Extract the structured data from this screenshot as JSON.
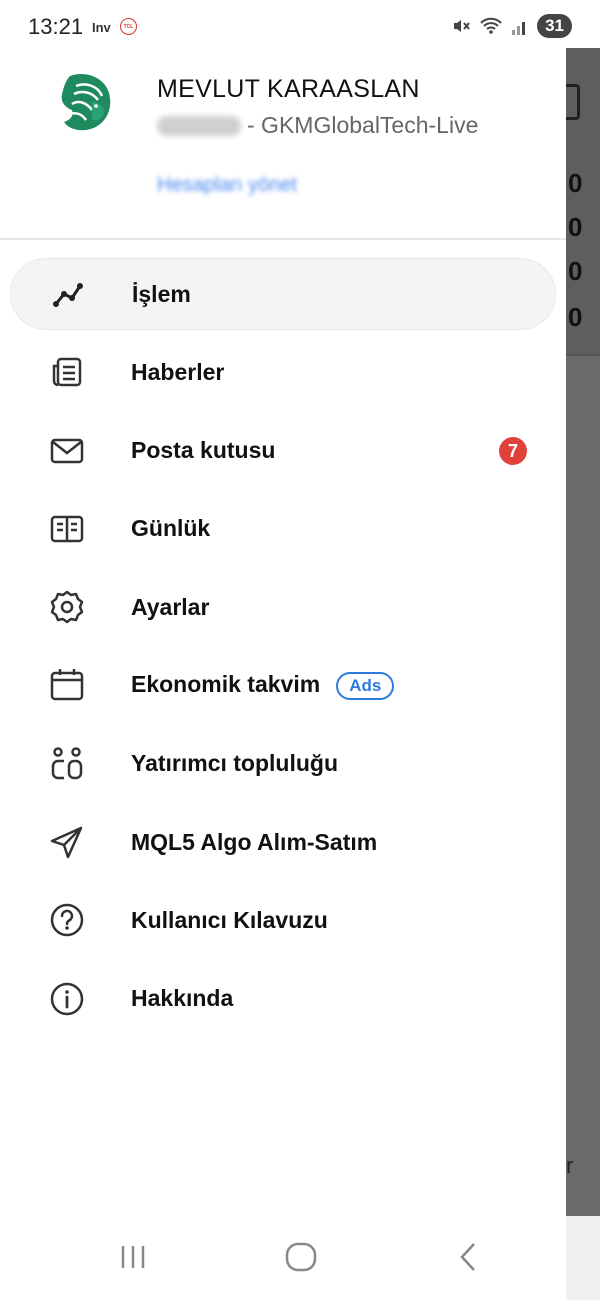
{
  "status_bar": {
    "time": "13:21",
    "app_tag": "Inv",
    "carrier_badge": "TCL",
    "battery": "31"
  },
  "drawer": {
    "user_name": "MEVLUT KARAASLAN",
    "account_server": "- GKMGlobalTech-Live",
    "manage_accounts": "Hesapları yönet",
    "menu": [
      {
        "label": "İşlem",
        "icon": "trade-chart-icon",
        "active": true
      },
      {
        "label": "Haberler",
        "icon": "news-icon"
      },
      {
        "label": "Posta kutusu",
        "icon": "mail-icon",
        "badge": "7"
      },
      {
        "label": "Günlük",
        "icon": "journal-icon"
      },
      {
        "label": "Ayarlar",
        "icon": "gear-icon"
      },
      {
        "label": "Ekonomik takvim",
        "icon": "calendar-icon",
        "tag": "Ads"
      },
      {
        "label": "Yatırımcı topluluğu",
        "icon": "community-icon"
      },
      {
        "label": "MQL5 Algo Alım-Satım",
        "icon": "send-icon"
      },
      {
        "label": "Kullanıcı Kılavuzu",
        "icon": "help-icon"
      },
      {
        "label": "Hakkında",
        "icon": "info-icon"
      }
    ]
  },
  "background_app": {
    "digits": [
      "0",
      "0",
      "0",
      "0"
    ],
    "partial_letter": "r"
  },
  "colors": {
    "badge": "#e0413b",
    "ads": "#2d7be0",
    "link": "#4a86f0",
    "logo": "#1f8a5e"
  }
}
